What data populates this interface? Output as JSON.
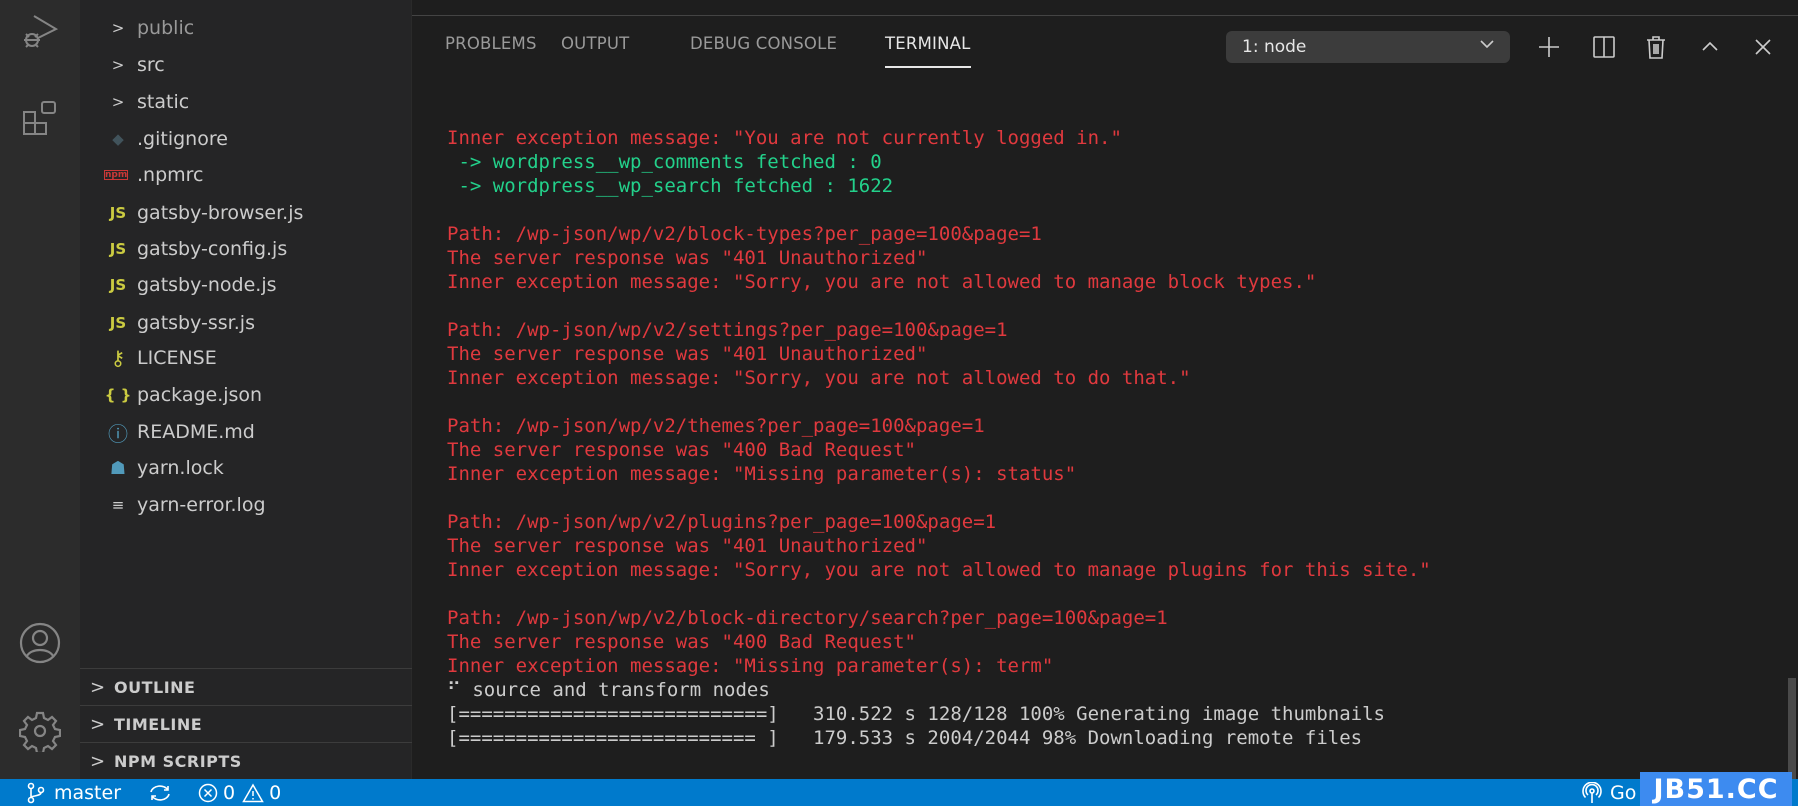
{
  "activity_bar": {
    "items": [
      "run-debug",
      "extensions",
      "accounts",
      "manage"
    ]
  },
  "explorer": {
    "items": [
      {
        "label": "public",
        "type": "folder",
        "icon": "chevron-right"
      },
      {
        "label": "src",
        "type": "folder",
        "icon": "chevron-right"
      },
      {
        "label": "static",
        "type": "folder",
        "icon": "chevron-right"
      },
      {
        "label": ".gitignore",
        "type": "file",
        "icon": "git"
      },
      {
        "label": ".npmrc",
        "type": "file",
        "icon": "npm"
      },
      {
        "label": "gatsby-browser.js",
        "type": "file",
        "icon": "js"
      },
      {
        "label": "gatsby-config.js",
        "type": "file",
        "icon": "js"
      },
      {
        "label": "gatsby-node.js",
        "type": "file",
        "icon": "js"
      },
      {
        "label": "gatsby-ssr.js",
        "type": "file",
        "icon": "js"
      },
      {
        "label": "LICENSE",
        "type": "file",
        "icon": "license"
      },
      {
        "label": "package.json",
        "type": "file",
        "icon": "json"
      },
      {
        "label": "README.md",
        "type": "file",
        "icon": "info"
      },
      {
        "label": "yarn.lock",
        "type": "file",
        "icon": "yarn"
      },
      {
        "label": "yarn-error.log",
        "type": "file",
        "icon": "log"
      }
    ],
    "sections": [
      "OUTLINE",
      "TIMELINE",
      "NPM SCRIPTS"
    ]
  },
  "panel": {
    "tabs": [
      "PROBLEMS",
      "OUTPUT",
      "DEBUG CONSOLE",
      "TERMINAL"
    ],
    "active_tab": "TERMINAL",
    "terminal_select": "1: node"
  },
  "terminal": {
    "colors": {
      "error": "#e0393e",
      "success": "#23d18b",
      "normal": "#cccccc"
    },
    "lines": [
      {
        "text": "Inner exception message: \"You are not currently logged in.\"",
        "color": "red"
      },
      {
        "text": " -> wordpress__wp_comments fetched : 0",
        "color": "green"
      },
      {
        "text": " -> wordpress__wp_search fetched : 1622",
        "color": "green"
      },
      {
        "text": "",
        "color": "white"
      },
      {
        "text": "Path: /wp-json/wp/v2/block-types?per_page=100&page=1",
        "color": "red"
      },
      {
        "text": "The server response was \"401 Unauthorized\"",
        "color": "red"
      },
      {
        "text": "Inner exception message: \"Sorry, you are not allowed to manage block types.\"",
        "color": "red"
      },
      {
        "text": "",
        "color": "white"
      },
      {
        "text": "Path: /wp-json/wp/v2/settings?per_page=100&page=1",
        "color": "red"
      },
      {
        "text": "The server response was \"401 Unauthorized\"",
        "color": "red"
      },
      {
        "text": "Inner exception message: \"Sorry, you are not allowed to do that.\"",
        "color": "red"
      },
      {
        "text": "",
        "color": "white"
      },
      {
        "text": "Path: /wp-json/wp/v2/themes?per_page=100&page=1",
        "color": "red"
      },
      {
        "text": "The server response was \"400 Bad Request\"",
        "color": "red"
      },
      {
        "text": "Inner exception message: \"Missing parameter(s): status\"",
        "color": "red"
      },
      {
        "text": "",
        "color": "white"
      },
      {
        "text": "Path: /wp-json/wp/v2/plugins?per_page=100&page=1",
        "color": "red"
      },
      {
        "text": "The server response was \"401 Unauthorized\"",
        "color": "red"
      },
      {
        "text": "Inner exception message: \"Sorry, you are not allowed to manage plugins for this site.\"",
        "color": "red"
      },
      {
        "text": "",
        "color": "white"
      },
      {
        "text": "Path: /wp-json/wp/v2/block-directory/search?per_page=100&page=1",
        "color": "red"
      },
      {
        "text": "The server response was \"400 Bad Request\"",
        "color": "red"
      },
      {
        "text": "Inner exception message: \"Missing parameter(s): term\"",
        "color": "red"
      },
      {
        "text": "⠋ source and transform nodes",
        "color": "white"
      },
      {
        "text": "[===========================]   310.522 s 128/128 100% Generating image thumbnails",
        "color": "white"
      },
      {
        "text": "[========================== ]   179.533 s 2004/2044 98% Downloading remote files",
        "color": "white"
      }
    ]
  },
  "status_bar": {
    "branch": "master",
    "errors": "0",
    "warnings": "0",
    "go_live": "Go",
    "color": "#007acc"
  },
  "watermark": "JB51.CC"
}
